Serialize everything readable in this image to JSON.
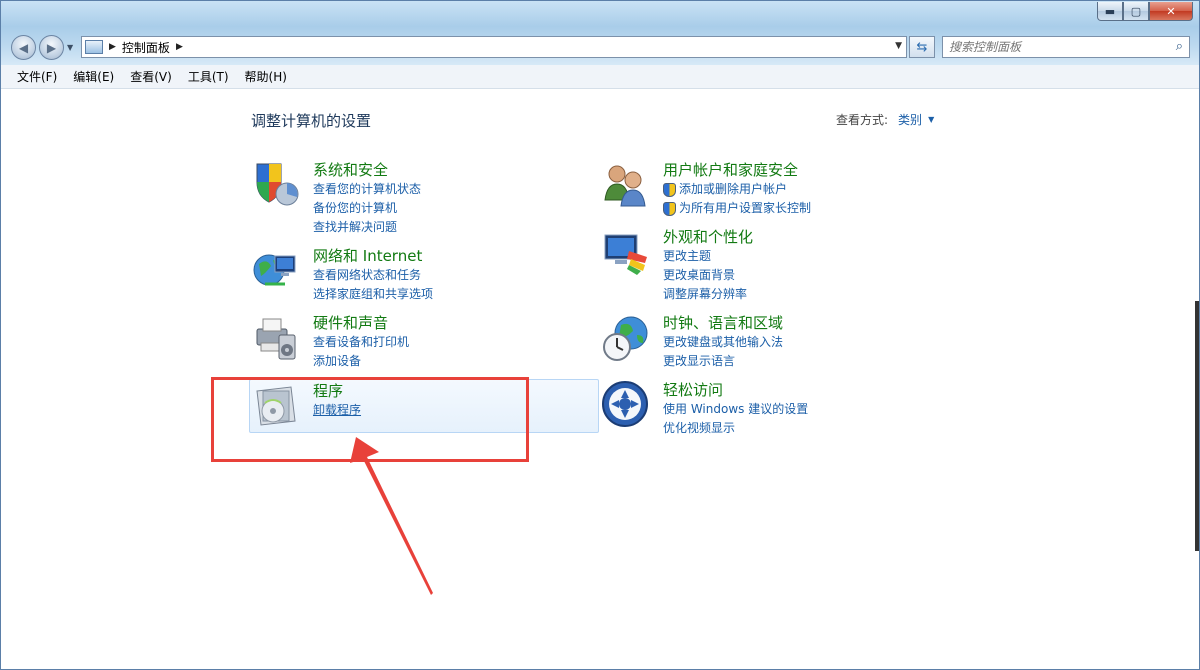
{
  "window": {
    "controls": {
      "minimize": "▬",
      "maximize": "▢",
      "close": "✕"
    }
  },
  "nav": {
    "back_icon": "◀",
    "forward_icon": "▶",
    "breadcrumb": "控制面板",
    "search_placeholder": "搜索控制面板"
  },
  "menu": [
    "文件(F)",
    "编辑(E)",
    "查看(V)",
    "工具(T)",
    "帮助(H)"
  ],
  "page": {
    "heading": "调整计算机的设置",
    "view_by_label": "查看方式:",
    "view_by_value": "类别"
  },
  "categories": [
    {
      "title": "系统和安全",
      "links": [
        "查看您的计算机状态",
        "备份您的计算机",
        "查找并解决问题"
      ]
    },
    {
      "title": "网络和 Internet",
      "links": [
        "查看网络状态和任务",
        "选择家庭组和共享选项"
      ]
    },
    {
      "title": "硬件和声音",
      "links": [
        "查看设备和打印机",
        "添加设备"
      ]
    },
    {
      "title": "程序",
      "links": [
        "卸载程序"
      ]
    },
    {
      "title": "用户帐户和家庭安全",
      "links": [
        "添加或删除用户帐户",
        "为所有用户设置家长控制"
      ]
    },
    {
      "title": "外观和个性化",
      "links": [
        "更改主题",
        "更改桌面背景",
        "调整屏幕分辨率"
      ]
    },
    {
      "title": "时钟、语言和区域",
      "links": [
        "更改键盘或其他输入法",
        "更改显示语言"
      ]
    },
    {
      "title": "轻松访问",
      "links": [
        "使用 Windows 建议的设置",
        "优化视频显示"
      ]
    }
  ],
  "colors": {
    "annotation": "#e8413a",
    "category_title": "#127a12",
    "link": "#1c5fa8"
  }
}
